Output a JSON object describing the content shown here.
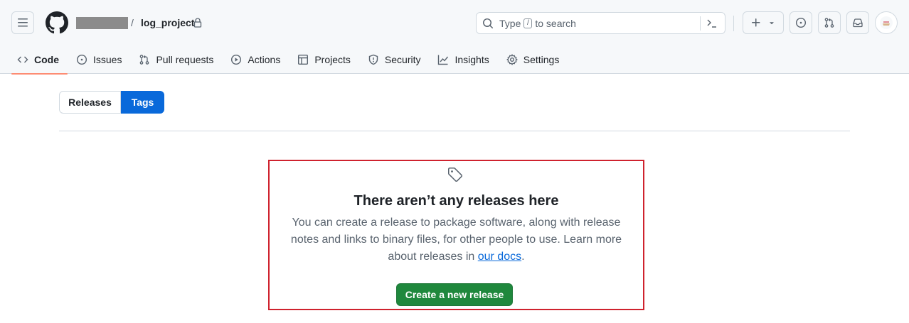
{
  "header": {
    "repo_name": "log_project",
    "breadcrumb_separator": "/",
    "search": {
      "prefix": "Type",
      "key": "/",
      "suffix": "to search"
    }
  },
  "tabs": [
    {
      "label": "Code",
      "icon": "code-icon",
      "active": true
    },
    {
      "label": "Issues",
      "icon": "issue-opened-icon"
    },
    {
      "label": "Pull requests",
      "icon": "git-pull-request-icon"
    },
    {
      "label": "Actions",
      "icon": "play-icon"
    },
    {
      "label": "Projects",
      "icon": "table-icon"
    },
    {
      "label": "Security",
      "icon": "shield-icon"
    },
    {
      "label": "Insights",
      "icon": "graph-icon"
    },
    {
      "label": "Settings",
      "icon": "gear-icon"
    }
  ],
  "segmented": {
    "releases": "Releases",
    "tags": "Tags",
    "selected": "Tags"
  },
  "blankslate": {
    "icon": "tag-icon",
    "title": "There aren’t any releases here",
    "text_before_link": "You can create a release to package software, along with release notes and links to binary files, for other people to use. Learn more about releases in ",
    "link_text": "our docs",
    "text_after_link": ".",
    "button": "Create a new release"
  },
  "colors": {
    "accent_blue": "#0969da",
    "create_green": "#1f883d",
    "highlight_red": "#cf222e",
    "active_tab_underline": "#fd8c73"
  }
}
